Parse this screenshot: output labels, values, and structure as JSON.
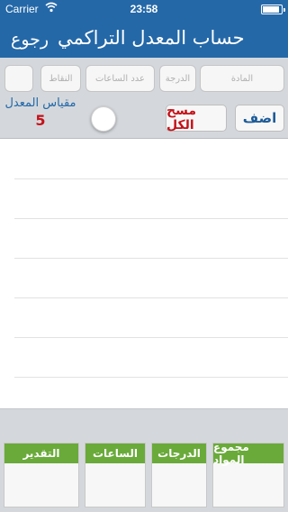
{
  "status_bar": {
    "carrier": "Carrier",
    "time": "23:58",
    "battery_level": 0.9
  },
  "nav": {
    "title": "حساب المعدل التراكمي",
    "back_label": "رجوع"
  },
  "form": {
    "subject_placeholder": "المادة",
    "grade_placeholder": "الدرجة",
    "hours_placeholder": "عدد الساعات",
    "points_placeholder": "النقاط",
    "blank_placeholder": ""
  },
  "actions": {
    "add_label": "اضف",
    "clear_all_label": "مسح الكل"
  },
  "scale": {
    "label": "مقياس المعدل",
    "value": "5",
    "toggle_on": false
  },
  "summary": {
    "total_subjects": {
      "header": "مجموع المواد",
      "value": ""
    },
    "grades": {
      "header": "الدرجات",
      "value": ""
    },
    "hours": {
      "header": "الساعات",
      "value": ""
    },
    "estimate": {
      "header": "التقدير",
      "value": ""
    }
  },
  "colors": {
    "nav_bar": "#2468a8",
    "summary_header": "#6aaa3a",
    "clear_button_text": "#c4121a",
    "add_button_text": "#1d5b98",
    "scale_value": "#c4121a"
  }
}
